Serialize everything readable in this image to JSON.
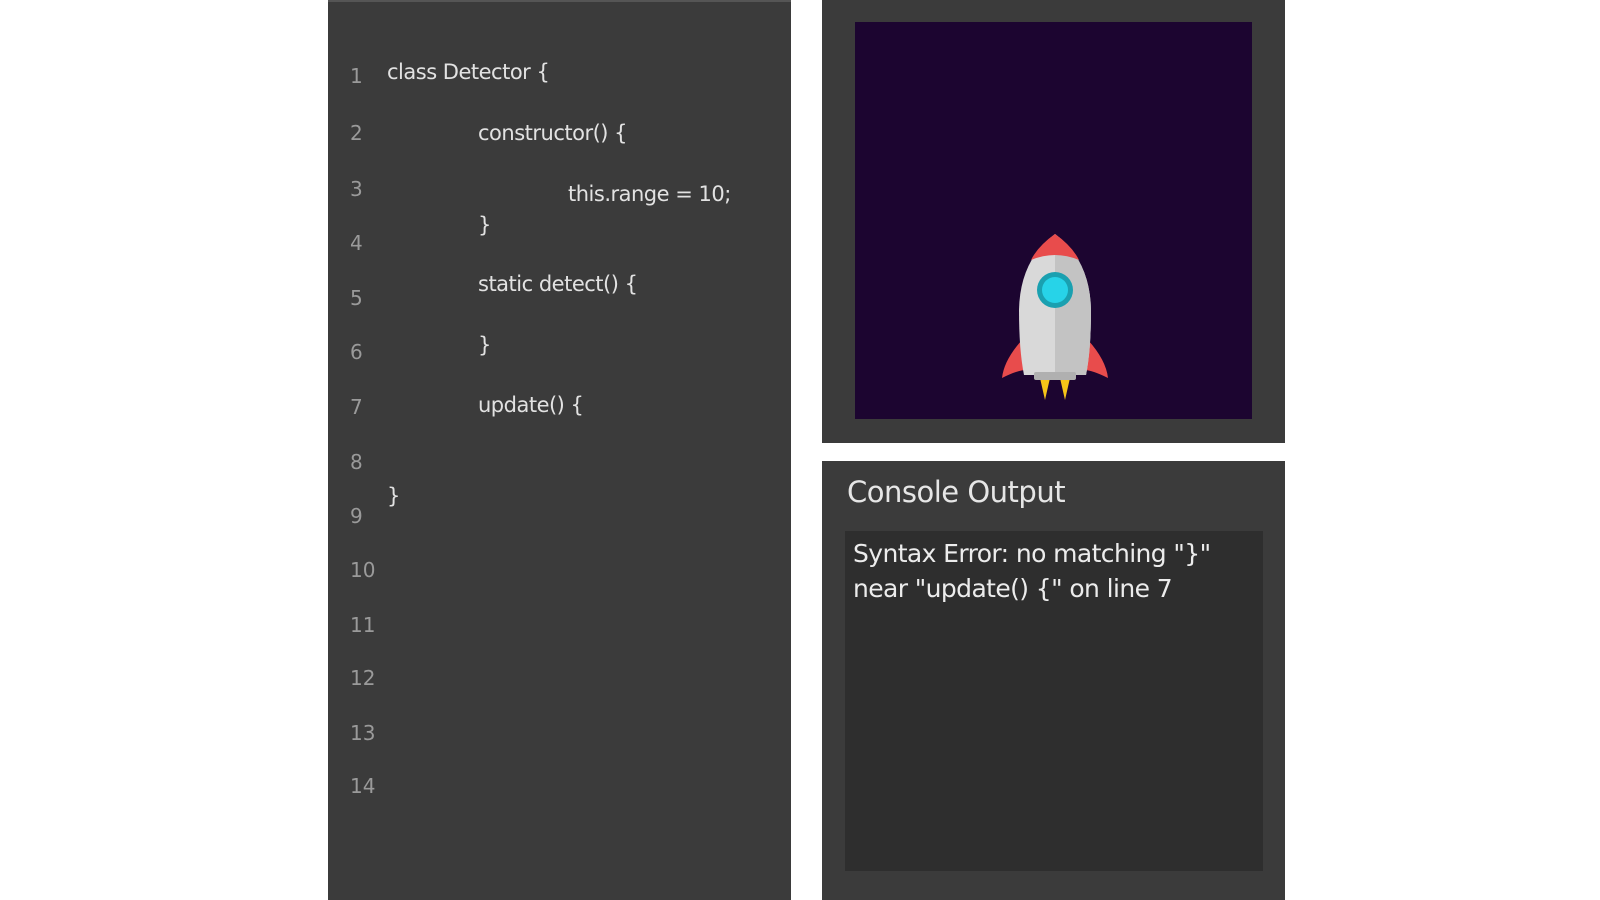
{
  "editor": {
    "line_numbers": [
      "1",
      "2",
      "3",
      "4",
      "5",
      "6",
      "7",
      "8",
      "9",
      "10",
      "11",
      "12",
      "13",
      "14"
    ],
    "code_lines": [
      "class Detector {",
      "constructor() {",
      "this.range = 10;",
      "}",
      "static detect() {",
      "}",
      "update() {",
      "}"
    ]
  },
  "preview": {
    "sprite_icon": "rocket-icon",
    "background_color": "#1c0530"
  },
  "console": {
    "title": "Console Output",
    "lines": [
      "Syntax Error: no matching \"}\"",
      "near \"update() {\" on line 7"
    ]
  }
}
